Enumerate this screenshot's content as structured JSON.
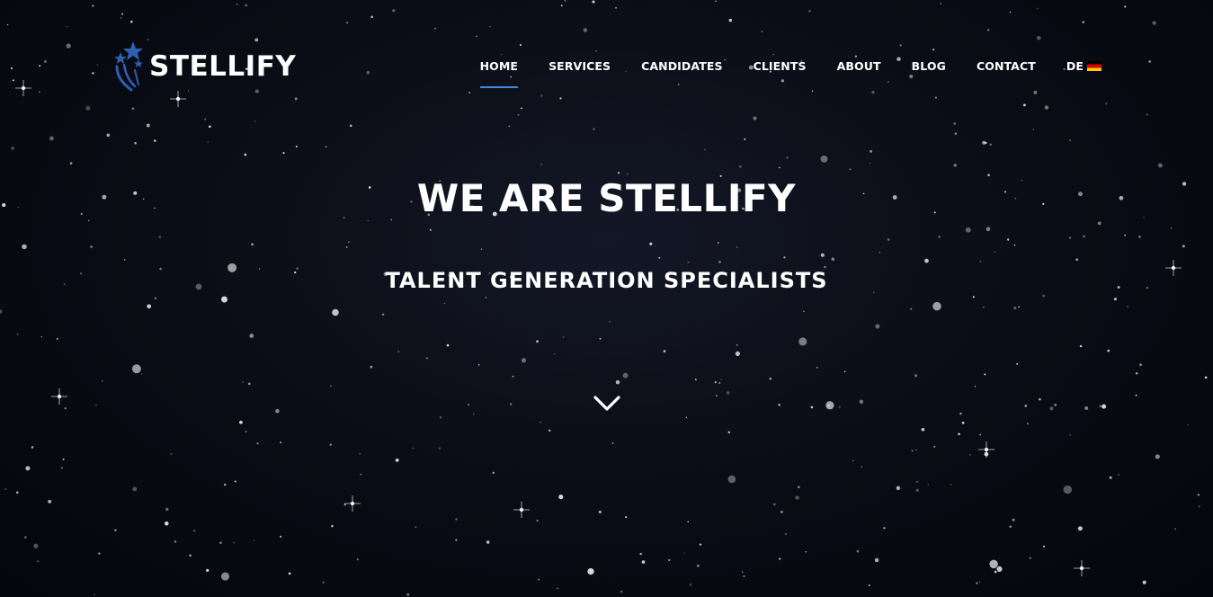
{
  "brand": {
    "name": "STELLIFY",
    "logo_icon": "shooting-stars-icon",
    "logo_color": "#2f5fb3"
  },
  "nav": {
    "items": [
      {
        "label": "HOME",
        "active": true
      },
      {
        "label": "SERVICES",
        "active": false
      },
      {
        "label": "CANDIDATES",
        "active": false
      },
      {
        "label": "CLIENTS",
        "active": false
      },
      {
        "label": "ABOUT",
        "active": false
      },
      {
        "label": "BLOG",
        "active": false
      },
      {
        "label": "CONTACT",
        "active": false
      }
    ],
    "language": {
      "label": "DE",
      "flag_icon": "german-flag-icon"
    },
    "active_underline_color": "#4a86d8"
  },
  "hero": {
    "title": "WE ARE STELLIFY",
    "subtitle": "TALENT GENERATION SPECIALISTS",
    "scroll_icon": "chevron-down-icon",
    "background": "starfield"
  }
}
